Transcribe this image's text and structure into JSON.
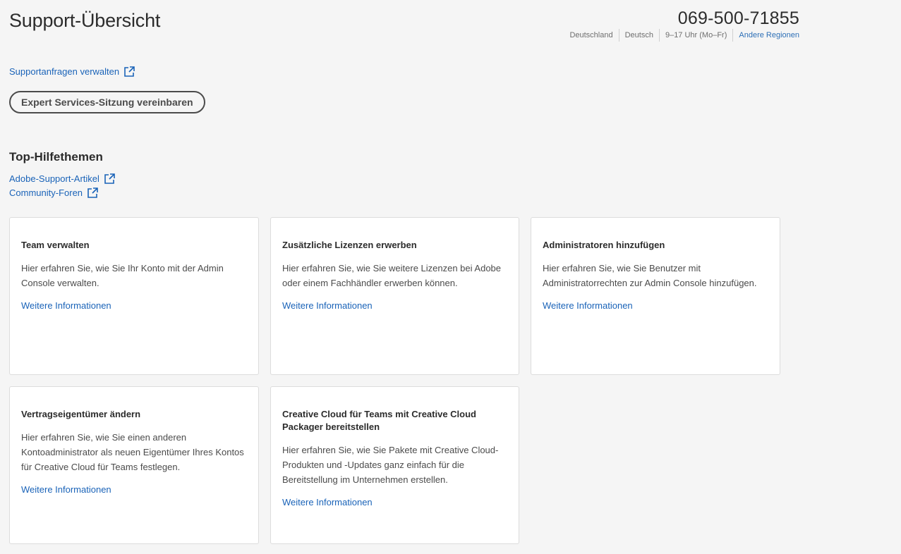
{
  "page": {
    "title": "Support-Übersicht"
  },
  "contact": {
    "phone": "069-500-71855",
    "country": "Deutschland",
    "language": "Deutsch",
    "hours": "9–17 Uhr (Mo–Fr)",
    "other_regions": "Andere Regionen"
  },
  "support": {
    "requests_link": "Supportanfragen verwalten",
    "expert_button": "Expert Services-Sitzung vereinbaren"
  },
  "help": {
    "title": "Top-Hilfethemen",
    "links": [
      "Adobe-Support-Artikel",
      "Community-Foren"
    ]
  },
  "cards": [
    {
      "title": "Team verwalten",
      "desc": "Hier erfahren Sie, wie Sie Ihr Konto mit der Admin Console verwalten.",
      "link": "Weitere Informationen"
    },
    {
      "title": "Zusätzliche Lizenzen erwerben",
      "desc": "Hier erfahren Sie, wie Sie weitere Lizenzen bei Adobe oder einem Fachhändler erwerben können.",
      "link": "Weitere Informationen"
    },
    {
      "title": "Administratoren hinzufügen",
      "desc": "Hier erfahren Sie, wie Sie Benutzer mit Administratorrechten zur Admin Console hinzufügen.",
      "link": "Weitere Informationen"
    },
    {
      "title": "Vertragseigentümer ändern",
      "desc": "Hier erfahren Sie, wie Sie einen anderen Kontoadministrator als neuen Eigentümer Ihres Kontos für Creative Cloud für Teams festlegen.",
      "link": "Weitere Informationen"
    },
    {
      "title": "Creative Cloud für Teams mit Creative Cloud Packager bereitstellen",
      "desc": "Hier erfahren Sie, wie Sie Pakete mit Creative Cloud-Produkten und -Updates ganz einfach für die Bereitstellung im Unternehmen erstellen.",
      "link": "Weitere Informationen"
    }
  ],
  "icons": {
    "external": "external-link-icon"
  },
  "colors": {
    "link": "#1a63b8",
    "background": "#f5f5f5",
    "card": "#ffffff"
  }
}
